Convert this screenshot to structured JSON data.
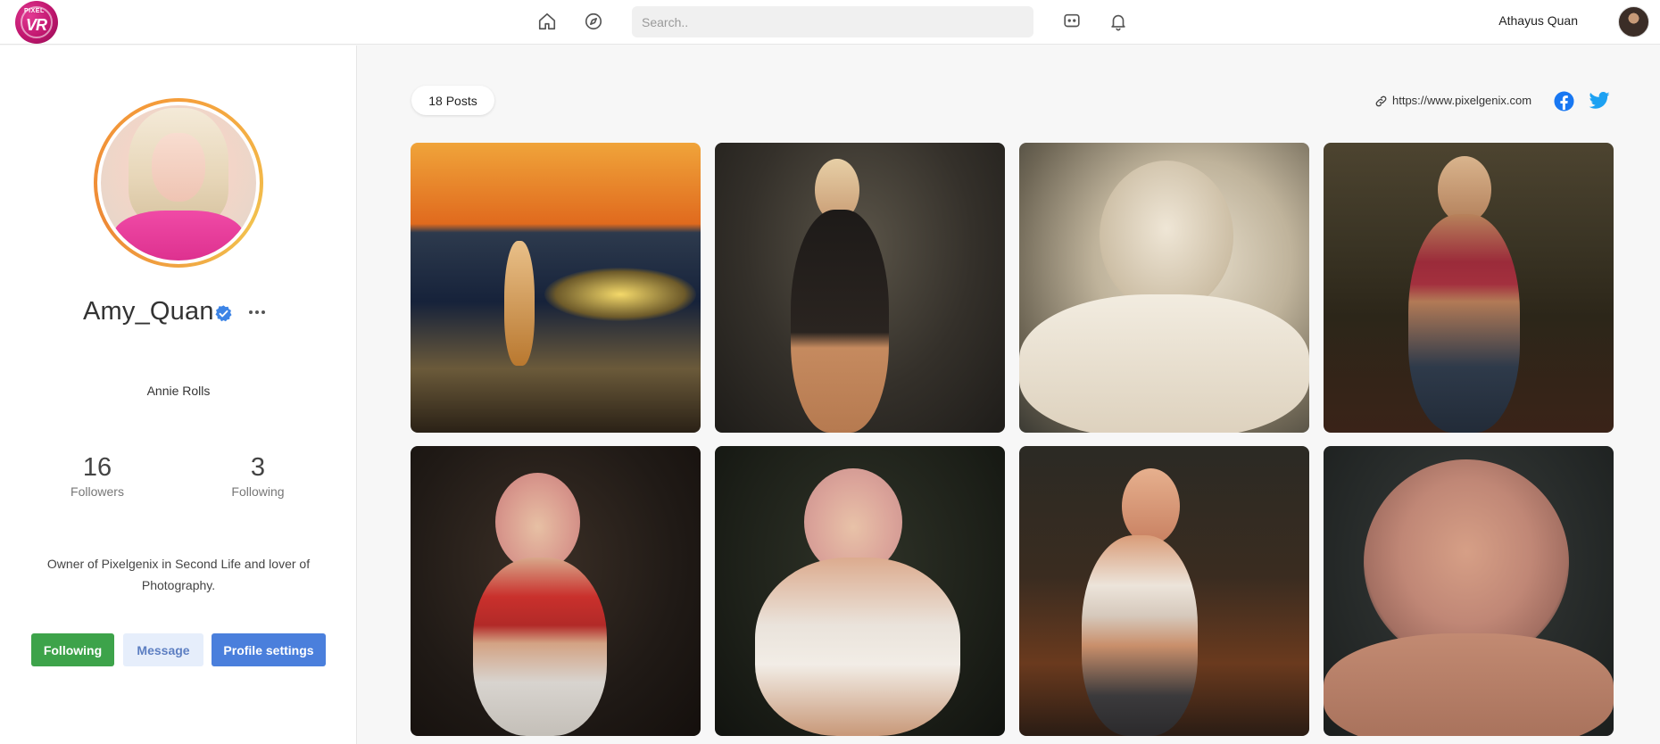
{
  "app": {
    "logo_small": "PIXEL",
    "logo_big": "VR"
  },
  "topbar": {
    "search_placeholder": "Search..",
    "icons": [
      "home-icon",
      "compass-icon",
      "chat-icon",
      "bell-icon"
    ],
    "user_name": "Athayus Quan"
  },
  "profile": {
    "username": "Amy_Quan",
    "display_name": "Annie Rolls",
    "followers_count": "16",
    "followers_label": "Followers",
    "following_count": "3",
    "following_label": "Following",
    "bio": "Owner of Pixelgenix in Second Life and lover of Photography.",
    "buttons": {
      "following": "Following",
      "message": "Message",
      "settings": "Profile settings"
    }
  },
  "main": {
    "posts_label": "18 Posts",
    "website": "https://www.pixelgenix.com",
    "posts_count": 8
  },
  "colors": {
    "accent_blue": "#4a7fdc",
    "following_green": "#3da34a",
    "message_bg": "#e6eefb",
    "verified_blue": "#3d84e6",
    "facebook": "#1877f2",
    "twitter": "#1da1f2",
    "logo_pink": "#c0166e"
  }
}
